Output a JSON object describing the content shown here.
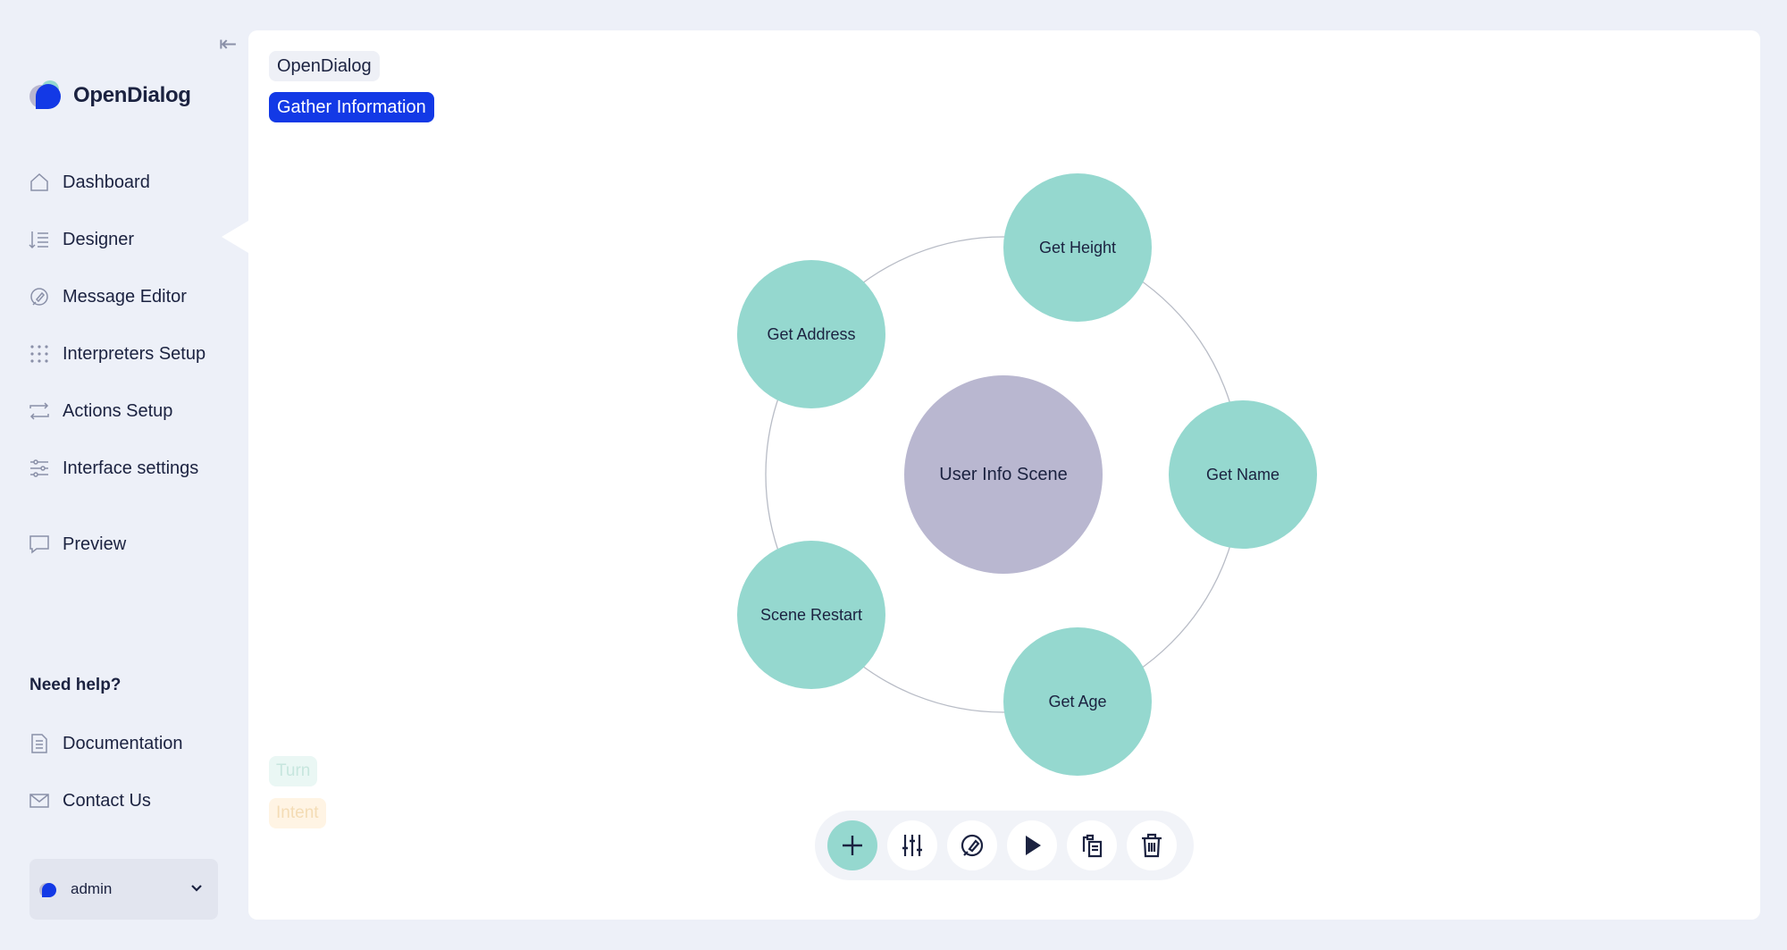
{
  "app": {
    "name": "OpenDialog",
    "colors": {
      "brand": "#1339e6",
      "turn": "#95d8cf",
      "scene": "#b9b7d0",
      "intent": "#fff4e4",
      "background": "#edf0f8"
    }
  },
  "sidebar": {
    "collapse_icon": "arrow-to-left-icon",
    "nav": [
      {
        "label": "Dashboard",
        "icon": "home-icon"
      },
      {
        "label": "Designer",
        "icon": "designer-icon",
        "active": true
      },
      {
        "label": "Message Editor",
        "icon": "message-edit-icon"
      },
      {
        "label": "Interpreters Setup",
        "icon": "dots-grid-icon"
      },
      {
        "label": "Actions Setup",
        "icon": "swap-arrows-icon"
      },
      {
        "label": "Interface settings",
        "icon": "sliders-icon"
      },
      {
        "label": "Preview",
        "icon": "chat-bubble-icon"
      }
    ],
    "help_title": "Need help?",
    "help": [
      {
        "label": "Documentation",
        "icon": "document-icon"
      },
      {
        "label": "Contact Us",
        "icon": "mail-icon"
      }
    ],
    "user": {
      "name": "admin"
    }
  },
  "breadcrumb": {
    "scenario": "OpenDialog",
    "conversation": "Gather Information"
  },
  "graph": {
    "center": {
      "label": "User Info Scene"
    },
    "turns": [
      {
        "label": "Get Height"
      },
      {
        "label": "Get Name"
      },
      {
        "label": "Get Age"
      },
      {
        "label": "Scene Restart"
      },
      {
        "label": "Get Address"
      }
    ]
  },
  "legend": {
    "turn": "Turn",
    "intent": "Intent"
  },
  "toolbar": {
    "buttons": [
      {
        "name": "add",
        "icon": "plus-icon"
      },
      {
        "name": "settings",
        "icon": "sliders-vertical-icon"
      },
      {
        "name": "messages",
        "icon": "message-edit-icon"
      },
      {
        "name": "preview",
        "icon": "play-icon"
      },
      {
        "name": "duplicate",
        "icon": "clipboard-copy-icon"
      },
      {
        "name": "delete",
        "icon": "trash-icon"
      }
    ]
  }
}
